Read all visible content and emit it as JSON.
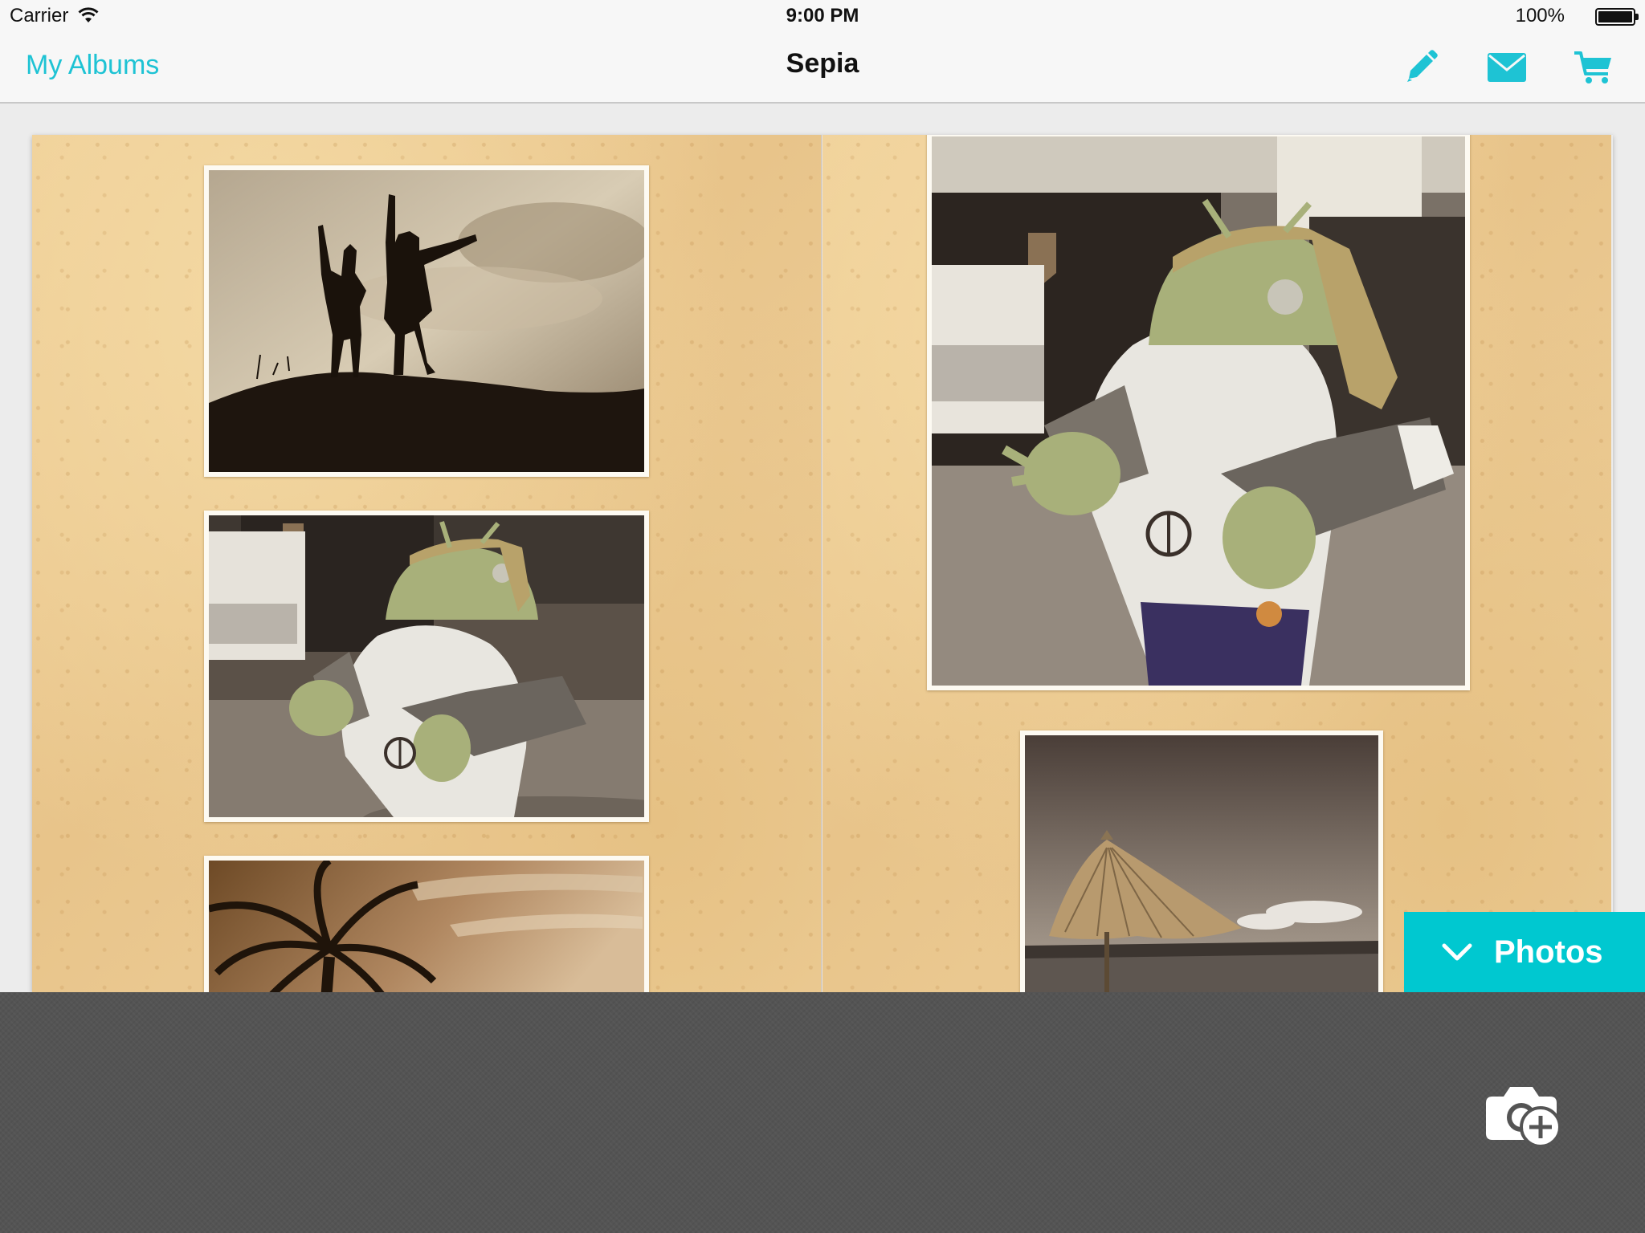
{
  "status_bar": {
    "carrier": "Carrier",
    "time": "9:00 PM",
    "battery": "100%",
    "battery_level": 1.0
  },
  "nav": {
    "back_label": "My Albums",
    "title": "Sepia",
    "actions": [
      {
        "name": "edit",
        "icon": "pencil-icon"
      },
      {
        "name": "email",
        "icon": "mail-icon"
      },
      {
        "name": "cart",
        "icon": "cart-icon"
      }
    ]
  },
  "album": {
    "pages": [
      {
        "photos": [
          "silhouette-girls-hill",
          "android-mascot-street",
          "palm-tree-sky"
        ]
      },
      {
        "photos": [
          "android-mascot-closeup",
          "beach-umbrella"
        ]
      }
    ]
  },
  "photos_drawer": {
    "tab_label": "Photos",
    "add_icon": "camera-add-icon"
  },
  "colors": {
    "accent": "#1ec3d4",
    "tab": "#00c8d0",
    "drawer": "#545454",
    "paper": "#ebc88e"
  }
}
